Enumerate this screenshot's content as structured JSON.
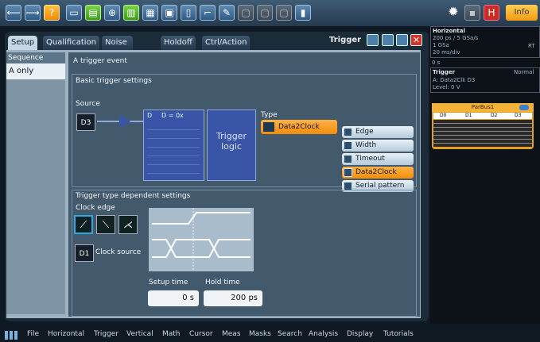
{
  "toolbar": {
    "info_label": "Info"
  },
  "side": {
    "horiz_title": "Horizontal",
    "rate": "200 ps / 5 GSa/s",
    "rt": "RT",
    "val1": "1 GSa",
    "div": "20 ms/div",
    "zero": "0 s",
    "trig_title": "Trigger",
    "mode": "Normal",
    "line1": "A:  Data2Clk  D3",
    "level": "Level: 0 V",
    "bus": "ParBus1",
    "bus_cols": [
      "D0",
      "D1",
      "D2",
      "D3"
    ]
  },
  "dialog": {
    "tabs": [
      "Setup",
      "Qualification",
      "Noise Reject",
      "Holdoff",
      "Ctrl/Action"
    ],
    "title": "Trigger",
    "sequence_label": "Sequence",
    "sequence_value": "A only",
    "event_heading": "A trigger event",
    "basic_heading": "Basic trigger settings",
    "source_label": "Source",
    "source_value": "D3",
    "block_text1": "D",
    "block_text2": "D = 0x",
    "trigger_logic": "Trigger logic",
    "type_label": "Type",
    "type_value": "Data2Clock",
    "type_options": [
      "Edge",
      "Width",
      "Timeout",
      "Data2Clock",
      "Serial pattern"
    ],
    "dep_heading": "Trigger type dependent settings",
    "clock_edge_label": "Clock edge",
    "clock_source_value": "D1",
    "clock_source_label": "Clock source",
    "setup_time_label": "Setup time",
    "hold_time_label": "Hold time",
    "setup_time_value": "0 s",
    "hold_time_value": "200 ps"
  },
  "menubar": [
    "File",
    "Horizontal",
    "Trigger",
    "Vertical",
    "Math",
    "Cursor",
    "Meas",
    "Masks",
    "Search",
    "Analysis",
    "Display",
    "Tutorials"
  ]
}
